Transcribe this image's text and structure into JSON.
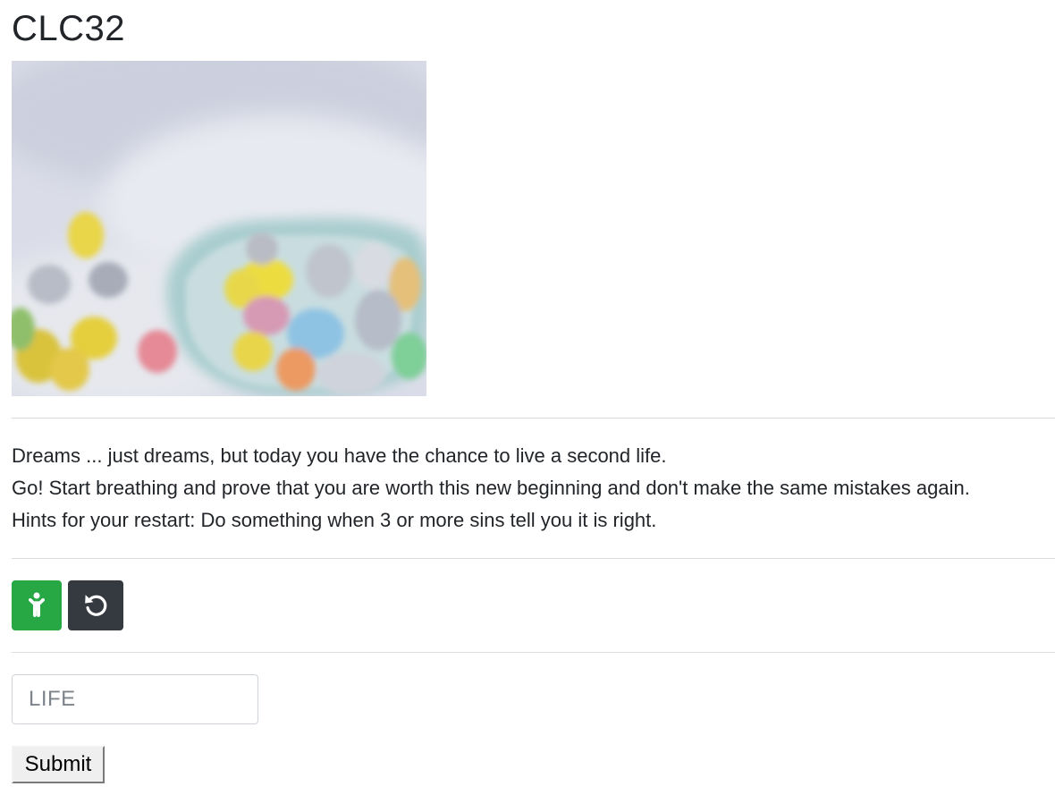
{
  "page": {
    "title": "CLC32"
  },
  "image": {
    "alt": "Blurred pastel easter eggs in a light blue bowl"
  },
  "story": {
    "lines": [
      "Dreams ... just dreams, but today you have the chance to live a second life.",
      "Go! Start breathing and prove that you are worth this new beginning and don't make the same mistakes again.",
      "Hints for your restart: Do something when 3 or more sins tell you it is right."
    ]
  },
  "buttons": {
    "start": {
      "icon": "child-person-icon",
      "color": "#28a745"
    },
    "reset": {
      "icon": "undo-icon",
      "color": "#343a40"
    }
  },
  "form": {
    "input_placeholder": "LIFE",
    "input_value": "",
    "submit_label": "Submit"
  }
}
